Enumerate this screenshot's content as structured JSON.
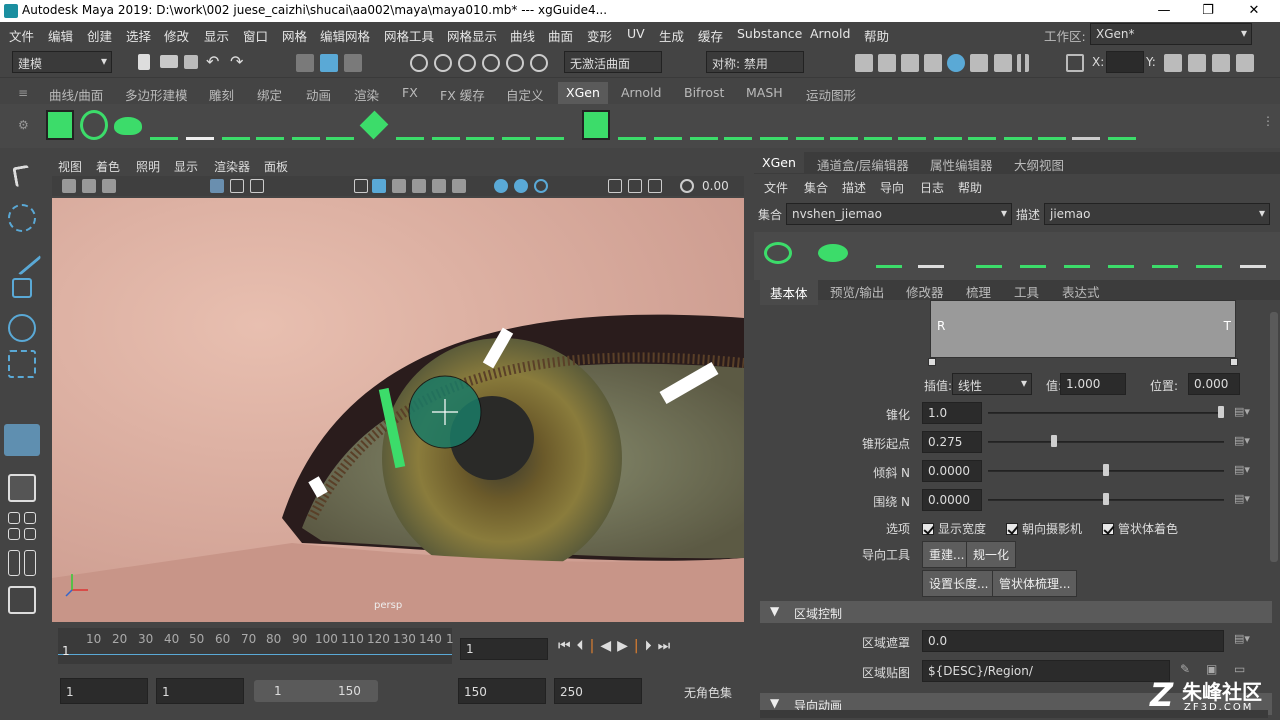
{
  "window": {
    "title": "Autodesk Maya 2019: D:\\work\\002 juese_caizhi\\shucai\\aa002\\maya\\maya010.mb*   ---   xgGuide4...",
    "controls": [
      "—",
      "❐",
      "✕"
    ]
  },
  "menubar": {
    "items": [
      "文件",
      "编辑",
      "创建",
      "选择",
      "修改",
      "显示",
      "窗口",
      "网格",
      "编辑网格",
      "网格工具",
      "网格显示",
      "曲线",
      "曲面",
      "变形",
      "UV",
      "生成",
      "缓存",
      "Substance",
      "Arnold",
      "帮助"
    ],
    "workspace_label": "工作区:",
    "workspace_value": "XGen*"
  },
  "toolbar": {
    "mode": "建模",
    "live_surface": "无激活曲面",
    "symmetry": "对称: 禁用",
    "x_label": "X:",
    "y_label": "Y:"
  },
  "shelf": {
    "tabs": [
      "曲线/曲面",
      "多边形建模",
      "雕刻",
      "绑定",
      "动画",
      "渲染",
      "FX",
      "FX 缓存",
      "自定义",
      "XGen",
      "Arnold",
      "Bifrost",
      "MASH",
      "运动图形"
    ],
    "active_tab": "XGen"
  },
  "viewport": {
    "menu": [
      "视图",
      "着色",
      "照明",
      "显示",
      "渲染器",
      "面板"
    ],
    "exposure_value": "0.00",
    "camera_label": "persp"
  },
  "timeline": {
    "ticks": [
      "10",
      "20",
      "30",
      "40",
      "50",
      "60",
      "70",
      "80",
      "90",
      "100",
      "110",
      "120",
      "130",
      "140",
      "1"
    ],
    "start_tick": "1",
    "current_frame": "1"
  },
  "range": {
    "start": "1",
    "anim_start": "1",
    "slider_left": "1",
    "slider_right": "150",
    "end": "150",
    "anim_end": "250",
    "character_set": "无角色集"
  },
  "xgen": {
    "panel_tabs": [
      "XGen",
      "通道盒/层编辑器",
      "属性编辑器",
      "大纲视图"
    ],
    "active_panel_tab": "XGen",
    "menu": [
      "文件",
      "集合",
      "描述",
      "导向",
      "日志",
      "帮助"
    ],
    "collection_label": "集合",
    "collection_value": "nvshen_jiemao",
    "description_label": "描述",
    "description_value": "jiemao",
    "sub_tabs": [
      "基本体",
      "预览/输出",
      "修改器",
      "梳理",
      "工具",
      "表达式"
    ],
    "active_sub_tab": "基本体",
    "ramp": {
      "left_label": "R",
      "right_label": "T",
      "interp_label": "插值:",
      "interp_value": "线性",
      "value_label": "值:",
      "value": "1.000",
      "position_label": "位置:",
      "position": "0.000"
    },
    "attrs": [
      {
        "label": "锥化",
        "value": "1.0",
        "level": 1.0
      },
      {
        "label": "锥形起点",
        "value": "0.275",
        "level": 0.275
      },
      {
        "label": "倾斜 N",
        "value": "0.0000",
        "level": 0.5
      },
      {
        "label": "围绕 N",
        "value": "0.0000",
        "level": 0.5
      }
    ],
    "options_label": "选项",
    "options": [
      "显示宽度",
      "朝向摄影机",
      "管状体着色"
    ],
    "guide_tools_label": "导向工具",
    "guide_buttons": [
      "重建...",
      "规一化",
      "设置长度...",
      "管状体梳理..."
    ],
    "region_section": "区域控制",
    "region_mask_label": "区域遮罩",
    "region_mask_value": "0.0",
    "region_map_label": "区域贴图",
    "region_map_value": "${DESC}/Region/",
    "guide_anim_section": "导向动画"
  },
  "watermark": {
    "brand": "朱峰社区",
    "url": "ZF3D.COM"
  },
  "colors": {
    "accent_green": "#3cdc6a",
    "accent_blue": "#5aa9d6",
    "active_tool": "#5f8fb0"
  }
}
